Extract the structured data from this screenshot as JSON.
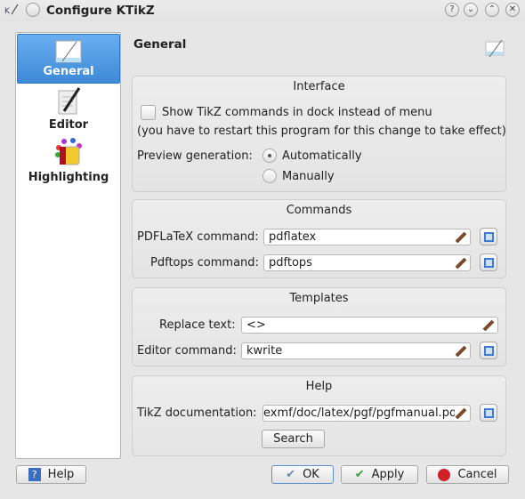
{
  "window": {
    "title": "Configure KTikZ",
    "buttons": [
      "?",
      "⌄",
      "⌃",
      "✕"
    ]
  },
  "sidebar": {
    "items": [
      {
        "label": "General",
        "icon": "window-icon",
        "selected": true
      },
      {
        "label": "Editor",
        "icon": "pen-document-icon"
      },
      {
        "label": "Highlighting",
        "icon": "paint-bucket-icon"
      }
    ]
  },
  "page": {
    "title": "General"
  },
  "interface": {
    "title": "Interface",
    "dock_checkbox": "Show TikZ commands in dock instead of menu",
    "dock_checked": false,
    "note": "(you have to restart this program for this change to take effect)",
    "preview_label": "Preview generation:",
    "preview_options": [
      "Automatically",
      "Manually"
    ],
    "preview_selected": "Automatically"
  },
  "commands": {
    "title": "Commands",
    "pdflatex_label": "PDFLaTeX command:",
    "pdflatex_value": "pdflatex",
    "pdftops_label": "Pdftops command:",
    "pdftops_value": "pdftops"
  },
  "templates": {
    "title": "Templates",
    "replace_label": "Replace text:",
    "replace_value": "<>",
    "editor_label": "Editor command:",
    "editor_value": "kwrite"
  },
  "help": {
    "title": "Help",
    "doc_label": "TikZ documentation:",
    "doc_value": "exmf/doc/latex/pgf/pgfmanual.pdf",
    "search": "Search"
  },
  "footer": {
    "help": "Help",
    "ok": "OK",
    "apply": "Apply",
    "cancel": "Cancel"
  }
}
